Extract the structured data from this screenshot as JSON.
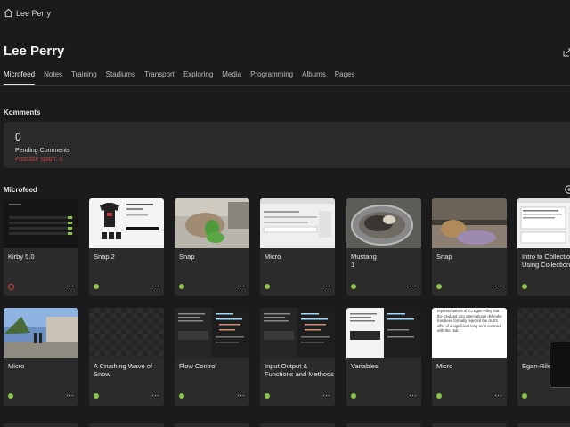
{
  "breadcrumb": {
    "label": "Lee Perry"
  },
  "title": "Lee Perry",
  "tabs": [
    {
      "label": "Microfeed",
      "active": true
    },
    {
      "label": "Notes"
    },
    {
      "label": "Training"
    },
    {
      "label": "Stadiums"
    },
    {
      "label": "Transport"
    },
    {
      "label": "Exploring"
    },
    {
      "label": "Media"
    },
    {
      "label": "Programming"
    },
    {
      "label": "Albums"
    },
    {
      "label": "Pages"
    }
  ],
  "komments": {
    "heading": "Komments",
    "pending_count": "0",
    "pending_label": "Pending Comments",
    "spam_label": "Possible spam: 0"
  },
  "microfeed": {
    "heading": "Microfeed",
    "more_label": "···",
    "cards": [
      {
        "title": "Kirby 5.0",
        "subtitle": "",
        "status": "error",
        "thumb": "dark-ui"
      },
      {
        "title": "Snap 2",
        "subtitle": "",
        "status": "ok",
        "thumb": "shop"
      },
      {
        "title": "Snap",
        "subtitle": "",
        "status": "ok",
        "thumb": "dog-toy"
      },
      {
        "title": "Micro",
        "subtitle": "",
        "status": "ok",
        "thumb": "light-ui"
      },
      {
        "title": "Mustang",
        "subtitle": "1",
        "status": "ok",
        "thumb": "dog-bed"
      },
      {
        "title": "Snap",
        "subtitle": "",
        "status": "ok",
        "thumb": "dog-couch"
      },
      {
        "title": "Intro to Collections Using Collections",
        "subtitle": "",
        "status": "ok",
        "thumb": "light-doc"
      },
      {
        "title": "Micro",
        "subtitle": "",
        "status": "ok",
        "thumb": "street"
      },
      {
        "title": "A Crushing Wave of Snow",
        "subtitle": "",
        "status": "ok",
        "thumb": "empty"
      },
      {
        "title": "Flow Control",
        "subtitle": "",
        "status": "ok",
        "thumb": "code"
      },
      {
        "title": "Input Output & Functions and Methods",
        "subtitle": "",
        "status": "ok",
        "thumb": "code"
      },
      {
        "title": "Variables",
        "subtitle": "",
        "status": "ok",
        "thumb": "code-light"
      },
      {
        "title": "Micro",
        "subtitle": "",
        "status": "ok",
        "thumb": "article"
      },
      {
        "title": "Egan-Riley leave for",
        "subtitle": "",
        "status": "ok",
        "thumb": "empty"
      }
    ],
    "article_snippet": "representatives of CJ Egan-Riley that the England U21 international defender has been formally rejected the club's offer of a significant long-term contract with the club."
  },
  "colors": {
    "status_ok": "#8bc34a",
    "status_error": "#d04040",
    "spam": "#c64545"
  }
}
